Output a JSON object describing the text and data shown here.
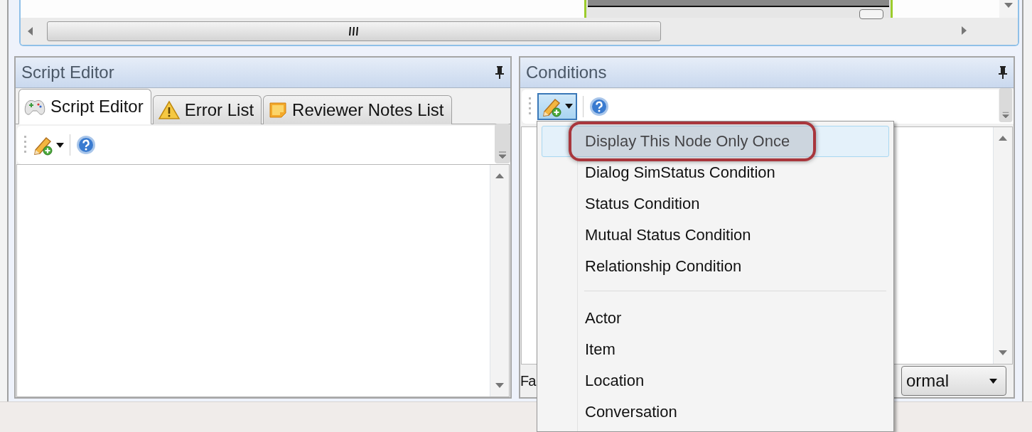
{
  "script_editor": {
    "title": "Script Editor",
    "tabs": [
      {
        "label": "Script Editor",
        "selected": true
      },
      {
        "label": "Error List",
        "selected": false
      },
      {
        "label": "Reviewer Notes List",
        "selected": false
      }
    ]
  },
  "conditions": {
    "title": "Conditions",
    "add_button": {
      "pressed": true
    },
    "footer_label": "Fa",
    "combo_value": "ormal"
  },
  "menu": {
    "items": [
      {
        "kind": "item",
        "label": "Display This Node Only Once",
        "selected": true,
        "circled": true
      },
      {
        "kind": "item",
        "label": "Dialog SimStatus Condition",
        "selected": false,
        "circled": false
      },
      {
        "kind": "item",
        "label": "Status Condition",
        "selected": false,
        "circled": false
      },
      {
        "kind": "item",
        "label": "Mutual Status Condition",
        "selected": false,
        "circled": false
      },
      {
        "kind": "item",
        "label": "Relationship Condition",
        "selected": false,
        "circled": false
      },
      {
        "kind": "separator"
      },
      {
        "kind": "item",
        "label": "Actor",
        "selected": false,
        "circled": false
      },
      {
        "kind": "item",
        "label": "Item",
        "selected": false,
        "circled": false
      },
      {
        "kind": "item",
        "label": "Location",
        "selected": false,
        "circled": false
      },
      {
        "kind": "item",
        "label": "Conversation",
        "selected": false,
        "circled": false
      }
    ]
  }
}
